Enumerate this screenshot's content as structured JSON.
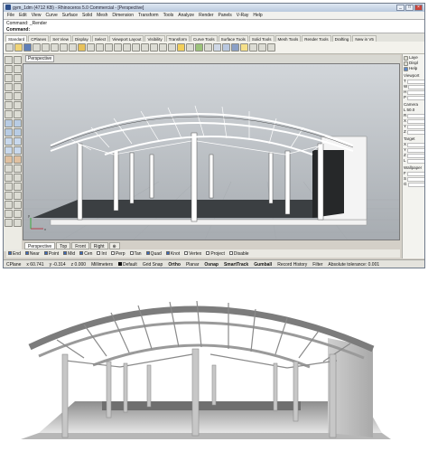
{
  "window": {
    "title": "gym_1dm (4712 KB) - Rhinoceros 5.0 Commercial - [Perspective]",
    "min_label": "_",
    "max_label": "□",
    "close_label": "×"
  },
  "menu": [
    "File",
    "Edit",
    "View",
    "Curve",
    "Surface",
    "Solid",
    "Mesh",
    "Dimension",
    "Transform",
    "Tools",
    "Analyze",
    "Render",
    "Panels",
    "V-Ray",
    "Help"
  ],
  "command": {
    "history_line": "Command: _Render",
    "prompt_label": "Command:"
  },
  "toolbar_tabs": [
    "Standard",
    "CPlanes",
    "Set View",
    "Display",
    "Select",
    "Viewport Layout",
    "Visibility",
    "Transform",
    "Curve Tools",
    "Surface Tools",
    "Solid Tools",
    "Mesh Tools",
    "Render Tools",
    "Drafting",
    "New in V5"
  ],
  "viewport": {
    "title": "Perspective",
    "axis_x": "x",
    "axis_y": "y"
  },
  "view_tabs": [
    "Perspective",
    "Top",
    "Front",
    "Right"
  ],
  "osnaps": [
    {
      "label": "End",
      "on": true
    },
    {
      "label": "Near",
      "on": true
    },
    {
      "label": "Point",
      "on": true
    },
    {
      "label": "Mid",
      "on": true
    },
    {
      "label": "Cen",
      "on": true
    },
    {
      "label": "Int",
      "on": false
    },
    {
      "label": "Perp",
      "on": false
    },
    {
      "label": "Tan",
      "on": false
    },
    {
      "label": "Quad",
      "on": true
    },
    {
      "label": "Knot",
      "on": true
    },
    {
      "label": "Vertex",
      "on": false
    },
    {
      "label": "Project",
      "on": false
    },
    {
      "label": "Disable",
      "on": false
    }
  ],
  "status": {
    "cplane": "CPlane",
    "x": "x 60.741",
    "y": "y -0.314",
    "z": "z 0.000",
    "units": "Millimeters",
    "layer": "Default",
    "buttons": [
      "Grid Snap",
      "Ortho",
      "Planar",
      "Osnap",
      "SmartTrack",
      "Gumball",
      "Record History",
      "Filter"
    ],
    "tolerance": "Absolute tolerance: 0.001"
  },
  "right_panel": {
    "tabs": [
      "Laye",
      "Displ",
      "Help"
    ],
    "viewport_label": "Viewport",
    "viewport_fields": [
      "T",
      "W",
      "H",
      "P"
    ],
    "camera_label": "Camera",
    "camera_fields": [
      "L",
      "R",
      "X",
      "Y",
      "Z"
    ],
    "camera_value": "50.0",
    "target_label": "Target",
    "target_fields": [
      "X",
      "Y",
      "Z",
      "L"
    ],
    "wallpaper_label": "Wallpaper",
    "wallpaper_fields": [
      "F",
      "S",
      "G"
    ]
  },
  "colors": {
    "floor_wireframe": "#3b3f42",
    "structure": "#ffffff",
    "render_bg": "#ffffff"
  }
}
